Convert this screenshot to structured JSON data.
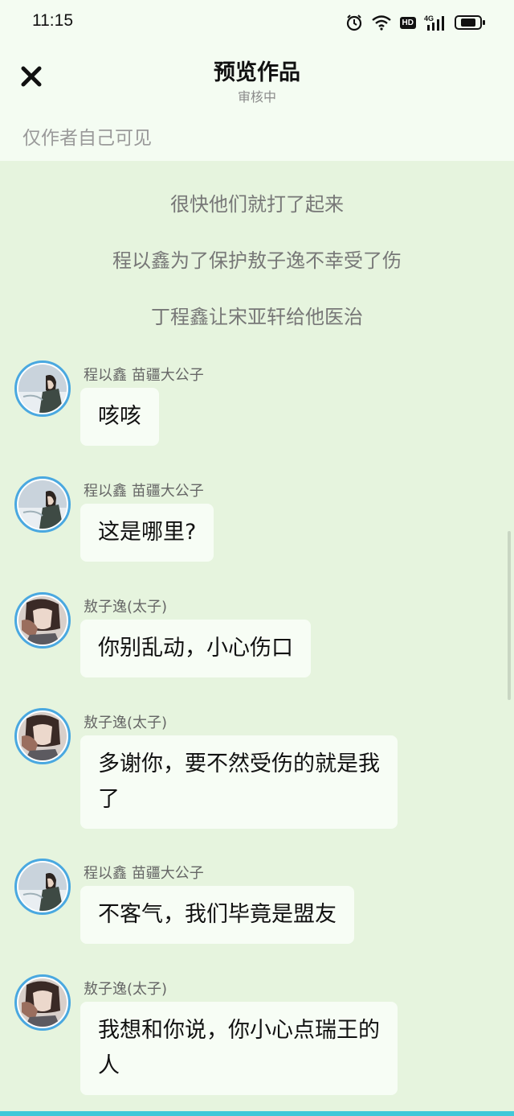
{
  "status_bar": {
    "time": "11:15",
    "icons": [
      "alarm-icon",
      "wifi-icon",
      "hd-icon",
      "signal-4g-icon",
      "battery-icon"
    ],
    "hd_label": "HD",
    "network_label": "4G"
  },
  "header": {
    "title": "预览作品",
    "subtitle": "审核中",
    "close_icon": "close-icon"
  },
  "visibility_note": "仅作者自己可见",
  "colors": {
    "top_bg": "#f4fcf2",
    "chat_bg": "#e6f4de",
    "bubble_bg": "#f7fdf5",
    "avatar_border": "#4aa8e0",
    "accent_strip": "#40c8d8"
  },
  "narration": [
    "很快他们就打了起来",
    "程以鑫为了保护敖子逸不幸受了伤",
    "丁程鑫让宋亚轩给他医治"
  ],
  "messages": [
    {
      "speaker": "程以鑫 苗疆大公子",
      "text": "咳咳",
      "avatar": "avatar-cheng"
    },
    {
      "speaker": "程以鑫 苗疆大公子",
      "text": "这是哪里?",
      "avatar": "avatar-cheng"
    },
    {
      "speaker": "敖子逸(太子)",
      "text": "你别乱动，小心伤口",
      "avatar": "avatar-ao"
    },
    {
      "speaker": "敖子逸(太子)",
      "text": "多谢你，要不然受伤的就是我\n了",
      "avatar": "avatar-ao"
    },
    {
      "speaker": "程以鑫 苗疆大公子",
      "text": "不客气，我们毕竟是盟友",
      "avatar": "avatar-cheng"
    },
    {
      "speaker": "敖子逸(太子)",
      "text": "我想和你说，你小心点瑞王的\n人",
      "avatar": "avatar-ao"
    }
  ]
}
